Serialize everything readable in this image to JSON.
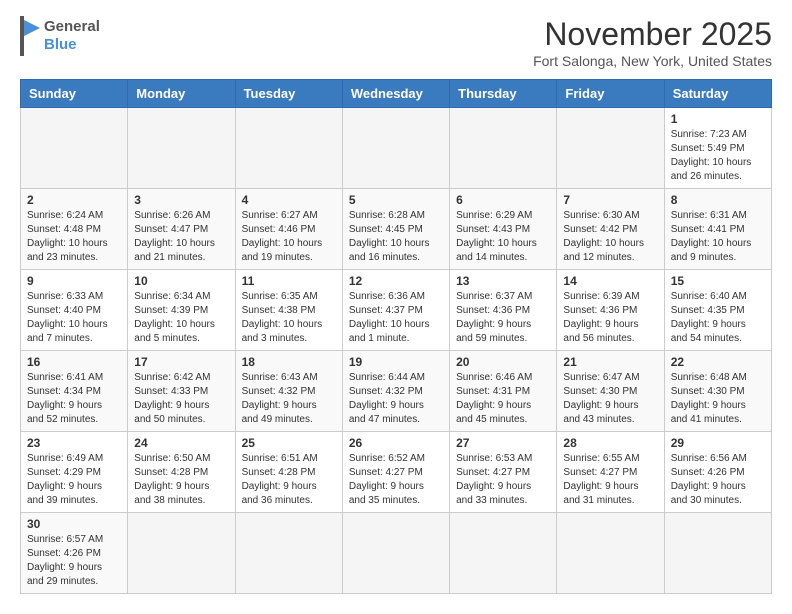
{
  "logo": {
    "text_general": "General",
    "text_blue": "Blue"
  },
  "title": "November 2025",
  "location": "Fort Salonga, New York, United States",
  "weekdays": [
    "Sunday",
    "Monday",
    "Tuesday",
    "Wednesday",
    "Thursday",
    "Friday",
    "Saturday"
  ],
  "weeks": [
    [
      {
        "day": "",
        "info": ""
      },
      {
        "day": "",
        "info": ""
      },
      {
        "day": "",
        "info": ""
      },
      {
        "day": "",
        "info": ""
      },
      {
        "day": "",
        "info": ""
      },
      {
        "day": "",
        "info": ""
      },
      {
        "day": "1",
        "info": "Sunrise: 7:23 AM\nSunset: 5:49 PM\nDaylight: 10 hours\nand 26 minutes."
      }
    ],
    [
      {
        "day": "2",
        "info": "Sunrise: 6:24 AM\nSunset: 4:48 PM\nDaylight: 10 hours\nand 23 minutes."
      },
      {
        "day": "3",
        "info": "Sunrise: 6:26 AM\nSunset: 4:47 PM\nDaylight: 10 hours\nand 21 minutes."
      },
      {
        "day": "4",
        "info": "Sunrise: 6:27 AM\nSunset: 4:46 PM\nDaylight: 10 hours\nand 19 minutes."
      },
      {
        "day": "5",
        "info": "Sunrise: 6:28 AM\nSunset: 4:45 PM\nDaylight: 10 hours\nand 16 minutes."
      },
      {
        "day": "6",
        "info": "Sunrise: 6:29 AM\nSunset: 4:43 PM\nDaylight: 10 hours\nand 14 minutes."
      },
      {
        "day": "7",
        "info": "Sunrise: 6:30 AM\nSunset: 4:42 PM\nDaylight: 10 hours\nand 12 minutes."
      },
      {
        "day": "8",
        "info": "Sunrise: 6:31 AM\nSunset: 4:41 PM\nDaylight: 10 hours\nand 9 minutes."
      }
    ],
    [
      {
        "day": "9",
        "info": "Sunrise: 6:33 AM\nSunset: 4:40 PM\nDaylight: 10 hours\nand 7 minutes."
      },
      {
        "day": "10",
        "info": "Sunrise: 6:34 AM\nSunset: 4:39 PM\nDaylight: 10 hours\nand 5 minutes."
      },
      {
        "day": "11",
        "info": "Sunrise: 6:35 AM\nSunset: 4:38 PM\nDaylight: 10 hours\nand 3 minutes."
      },
      {
        "day": "12",
        "info": "Sunrise: 6:36 AM\nSunset: 4:37 PM\nDaylight: 10 hours\nand 1 minute."
      },
      {
        "day": "13",
        "info": "Sunrise: 6:37 AM\nSunset: 4:36 PM\nDaylight: 9 hours\nand 59 minutes."
      },
      {
        "day": "14",
        "info": "Sunrise: 6:39 AM\nSunset: 4:36 PM\nDaylight: 9 hours\nand 56 minutes."
      },
      {
        "day": "15",
        "info": "Sunrise: 6:40 AM\nSunset: 4:35 PM\nDaylight: 9 hours\nand 54 minutes."
      }
    ],
    [
      {
        "day": "16",
        "info": "Sunrise: 6:41 AM\nSunset: 4:34 PM\nDaylight: 9 hours\nand 52 minutes."
      },
      {
        "day": "17",
        "info": "Sunrise: 6:42 AM\nSunset: 4:33 PM\nDaylight: 9 hours\nand 50 minutes."
      },
      {
        "day": "18",
        "info": "Sunrise: 6:43 AM\nSunset: 4:32 PM\nDaylight: 9 hours\nand 49 minutes."
      },
      {
        "day": "19",
        "info": "Sunrise: 6:44 AM\nSunset: 4:32 PM\nDaylight: 9 hours\nand 47 minutes."
      },
      {
        "day": "20",
        "info": "Sunrise: 6:46 AM\nSunset: 4:31 PM\nDaylight: 9 hours\nand 45 minutes."
      },
      {
        "day": "21",
        "info": "Sunrise: 6:47 AM\nSunset: 4:30 PM\nDaylight: 9 hours\nand 43 minutes."
      },
      {
        "day": "22",
        "info": "Sunrise: 6:48 AM\nSunset: 4:30 PM\nDaylight: 9 hours\nand 41 minutes."
      }
    ],
    [
      {
        "day": "23",
        "info": "Sunrise: 6:49 AM\nSunset: 4:29 PM\nDaylight: 9 hours\nand 39 minutes."
      },
      {
        "day": "24",
        "info": "Sunrise: 6:50 AM\nSunset: 4:28 PM\nDaylight: 9 hours\nand 38 minutes."
      },
      {
        "day": "25",
        "info": "Sunrise: 6:51 AM\nSunset: 4:28 PM\nDaylight: 9 hours\nand 36 minutes."
      },
      {
        "day": "26",
        "info": "Sunrise: 6:52 AM\nSunset: 4:27 PM\nDaylight: 9 hours\nand 35 minutes."
      },
      {
        "day": "27",
        "info": "Sunrise: 6:53 AM\nSunset: 4:27 PM\nDaylight: 9 hours\nand 33 minutes."
      },
      {
        "day": "28",
        "info": "Sunrise: 6:55 AM\nSunset: 4:27 PM\nDaylight: 9 hours\nand 31 minutes."
      },
      {
        "day": "29",
        "info": "Sunrise: 6:56 AM\nSunset: 4:26 PM\nDaylight: 9 hours\nand 30 minutes."
      }
    ],
    [
      {
        "day": "30",
        "info": "Sunrise: 6:57 AM\nSunset: 4:26 PM\nDaylight: 9 hours\nand 29 minutes."
      },
      {
        "day": "",
        "info": ""
      },
      {
        "day": "",
        "info": ""
      },
      {
        "day": "",
        "info": ""
      },
      {
        "day": "",
        "info": ""
      },
      {
        "day": "",
        "info": ""
      },
      {
        "day": "",
        "info": ""
      }
    ]
  ]
}
